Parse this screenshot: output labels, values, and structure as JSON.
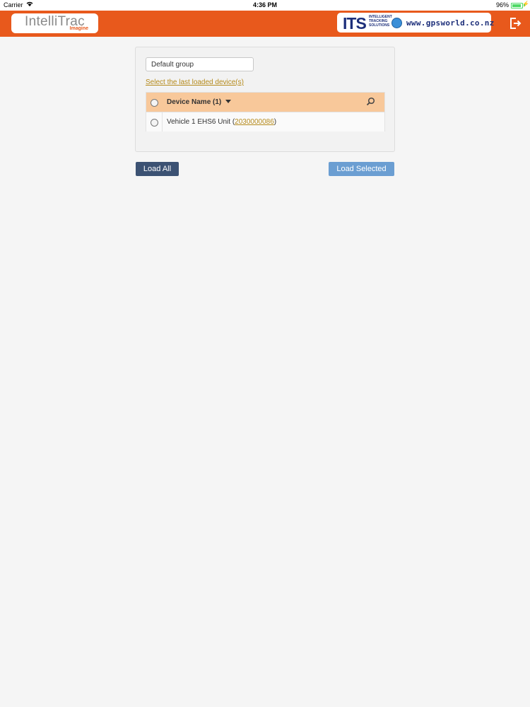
{
  "status_bar": {
    "carrier": "Carrier",
    "time": "4:36 PM",
    "battery": "96%"
  },
  "header": {
    "logo_name": "IntelliTrac",
    "logo_sub": "Imagine",
    "partner_logo": "ITS",
    "partner_sub_lines": [
      "INTELLIGENT",
      "TRACKING",
      "SOLUTIONS"
    ],
    "partner_site": "www.gpsworld.co.nz",
    "logout_icon": "logout-icon"
  },
  "panel": {
    "group_value": "Default group",
    "last_loaded_link": "Select the last loaded device(s)",
    "table": {
      "header_label": "Device Name (1)",
      "rows": [
        {
          "name_prefix": "Vehicle 1 EHS6 Unit (",
          "device_id": "2030000086",
          "name_suffix": ")"
        }
      ]
    }
  },
  "actions": {
    "load_all": "Load All",
    "load_selected": "Load Selected"
  },
  "colors": {
    "brand_orange": "#e8591c",
    "header_row": "#f8c89a",
    "link": "#b58a1c",
    "btn_dark": "#3c5273",
    "btn_light": "#6b9ed2"
  }
}
